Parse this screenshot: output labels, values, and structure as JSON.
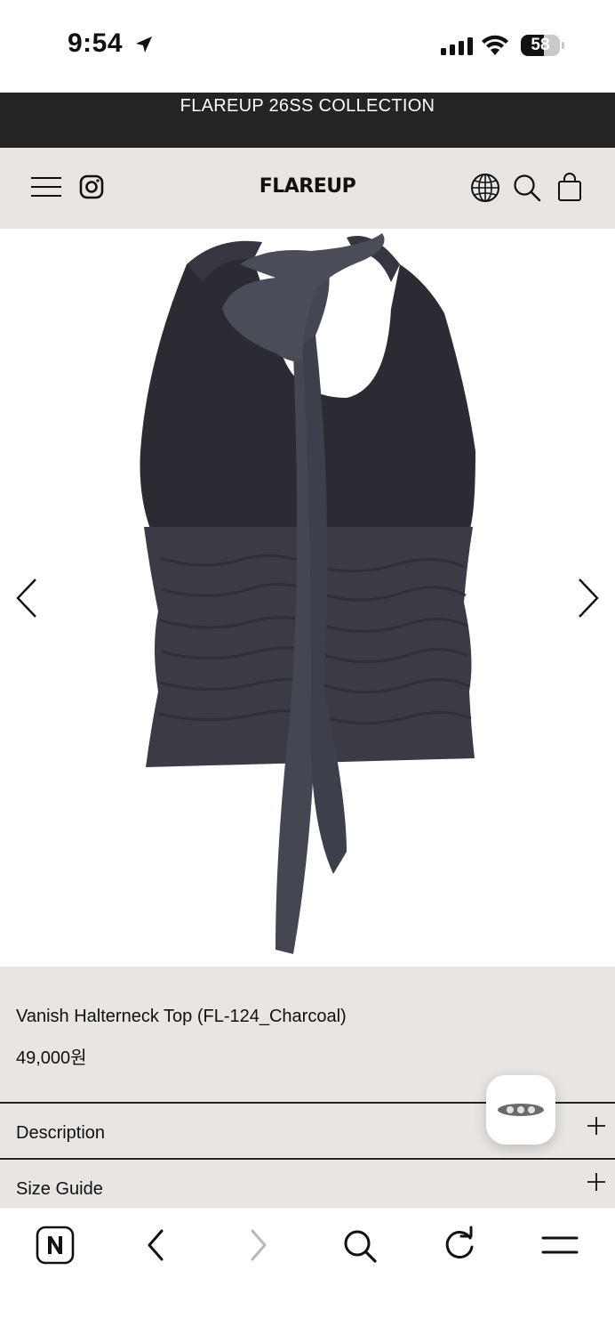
{
  "status_bar": {
    "time": "9:54",
    "battery": "58",
    "battery_level": 0.58
  },
  "announcement": {
    "text": "FLAREUP 26SS COLLECTION"
  },
  "header": {
    "logo": "FLAREUP",
    "icons": [
      "menu-icon",
      "instagram-icon",
      "globe-icon",
      "search-icon",
      "shopping-bag-icon"
    ]
  },
  "gallery": {
    "prev_icon": "chevron-left-icon",
    "next_icon": "chevron-right-icon",
    "garment_color": "#2f3038"
  },
  "product": {
    "name": "Vanish Halterneck Top (FL-124_Charcoal)",
    "price": "49,000원"
  },
  "accordion": [
    {
      "label": "Description",
      "icon": "plus-icon"
    },
    {
      "label": "Size Guide",
      "icon": "plus-icon"
    }
  ],
  "chat": {
    "icon": "chat-icon"
  },
  "browser_toolbar": {
    "icons": [
      "naver-icon",
      "back-icon",
      "forward-icon",
      "search-icon",
      "reload-icon",
      "menu-icon"
    ]
  },
  "colors": {
    "announce_bg": "#242424",
    "header_bg": "#e8e5e2",
    "text": "#111111"
  }
}
